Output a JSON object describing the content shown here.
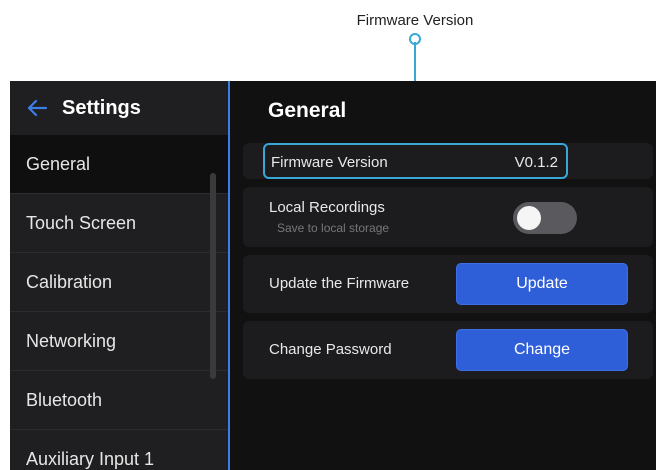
{
  "callout": {
    "label": "Firmware Version"
  },
  "sidebar": {
    "title": "Settings",
    "items": [
      {
        "label": "General",
        "active": true
      },
      {
        "label": "Touch Screen"
      },
      {
        "label": "Calibration"
      },
      {
        "label": "Networking"
      },
      {
        "label": "Bluetooth"
      },
      {
        "label": "Auxiliary Input 1"
      }
    ]
  },
  "main": {
    "title": "General",
    "firmware": {
      "label": "Firmware Version",
      "value": "V0.1.2"
    },
    "local_recordings": {
      "label": "Local Recordings",
      "sub": "Save to local storage",
      "enabled": false
    },
    "update": {
      "label": "Update the Firmware",
      "button": "Update"
    },
    "password": {
      "label": "Change Password",
      "button": "Change"
    }
  },
  "colors": {
    "accent": "#2f5fd8",
    "callout": "#39a7d6",
    "sidebar_divider": "#3a7ee6"
  }
}
